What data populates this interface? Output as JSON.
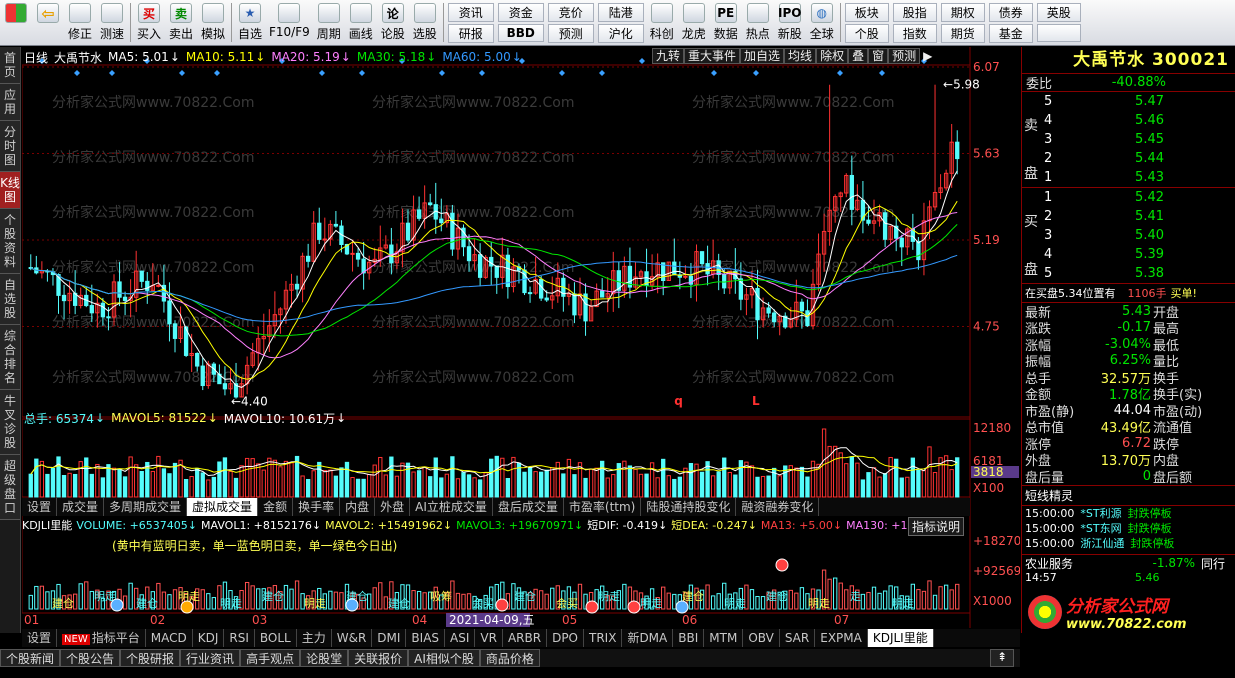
{
  "toolbar": {
    "items": [
      {
        "label": "",
        "icon": "grid-icon"
      },
      {
        "label": "",
        "icon": "back-arrow-icon"
      },
      {
        "label": "修正",
        "icon": "up-down-arrows-icon"
      },
      {
        "label": "测速",
        "icon": "timer-icon"
      },
      {
        "label": "买入",
        "icon": "buy-icon",
        "glyph": "买"
      },
      {
        "label": "卖出",
        "icon": "sell-icon",
        "glyph": "卖"
      },
      {
        "label": "模拟",
        "icon": "hammer-icon"
      },
      {
        "label": "自选",
        "icon": "star-icon"
      },
      {
        "label": "F10/F9",
        "icon": "f10-icon"
      },
      {
        "label": "周期",
        "icon": "cycle-icon"
      },
      {
        "label": "画线",
        "icon": "pen-icon"
      },
      {
        "label": "论股",
        "icon": "chat-icon",
        "glyph": "论"
      },
      {
        "label": "选股",
        "icon": "select-stock-icon"
      }
    ],
    "pairs": [
      [
        "资讯",
        "研报"
      ],
      [
        "资金",
        "BBD"
      ],
      [
        "竞价",
        "预测"
      ],
      [
        "陆港",
        "沪化"
      ]
    ],
    "items2": [
      {
        "label": "科创",
        "icon": "chart-icon"
      },
      {
        "label": "龙虎",
        "icon": "dragon-icon"
      },
      {
        "label": "数据",
        "icon": "pe-icon",
        "glyph": "PE"
      },
      {
        "label": "热点",
        "icon": "hot-icon"
      },
      {
        "label": "新股",
        "icon": "ipo-icon",
        "glyph": "IPO"
      },
      {
        "label": "全球",
        "icon": "globe-icon"
      }
    ],
    "pairs2": [
      [
        "板块",
        "个股"
      ],
      [
        "股指",
        "指数"
      ],
      [
        "期权",
        "期货"
      ],
      [
        "债券",
        "基金"
      ],
      [
        "英股",
        ""
      ]
    ]
  },
  "leftnav": [
    "首页",
    "应用",
    "分时图",
    "K线图",
    "个股资料",
    "自选股",
    "综合排名",
    "牛叉诊股",
    "超级盘口"
  ],
  "kline_header": {
    "period": "日线",
    "name": "大禹节水",
    "ma5": "MA5: 5.01",
    "ma10": "MA10: 5.11",
    "ma20": "MA20: 5.19",
    "ma30": "MA30: 5.18",
    "ma60": "MA60: 5.00",
    "buttons": [
      "九转",
      "重大事件",
      "加自选",
      "均线",
      "除权",
      "叠",
      "窗",
      "预测"
    ]
  },
  "price_axis": [
    "6.07",
    "5.63",
    "5.19",
    "4.75"
  ],
  "high_label": "5.98",
  "low_label": "4.40",
  "vol_header": {
    "total": "总手: 65374",
    "mavol5": "MAVOL5: 81522",
    "mavol10": "MAVOL10: 10.61万"
  },
  "vol_axis": [
    "12180",
    "6181",
    "3818",
    "X100"
  ],
  "vol_tabs": [
    "设置",
    "成交量",
    "多周期成交量",
    "虚拟成交量",
    "金额",
    "换手率",
    "内盘",
    "外盘",
    "AI立桩成交量",
    "盘后成交量",
    "市盈率(ttm)",
    "陆股通持股变化",
    "融资融券变化"
  ],
  "vol_tab_active": "虚拟成交量",
  "ind_header": {
    "name": "KDJLI里能",
    "volume": "VOLUME: +6537405",
    "mavol1": "MAVOL1: +8152176",
    "mavol2": "MAVOL2: +15491962",
    "mavol3": "MAVOL3: +19670971",
    "dif": "短DIF: -0.419",
    "dea": "短DEA: -0.247",
    "ma13": "MA13: +5.00",
    "ma130": "MA130: +11774",
    "explain": "指标说明"
  },
  "ind_note": "(黄中有蓝明日卖，单一蓝色明日卖，单一绿色今日出)",
  "ind_axis": [
    "+182702",
    "+92569",
    "X1000"
  ],
  "date_axis": [
    "01",
    "02",
    "03",
    "04",
    "05",
    "06",
    "07"
  ],
  "date_highlight": "2021-04-09,五",
  "ind_tabs": [
    "设置",
    "指标平台",
    "MACD",
    "KDJ",
    "RSI",
    "BOLL",
    "主力",
    "W&R",
    "DMI",
    "BIAS",
    "ASI",
    "VR",
    "ARBR",
    "DPO",
    "TRIX",
    "新DMA",
    "BBI",
    "MTM",
    "OBV",
    "SAR",
    "EXPMA",
    "KDJLI里能"
  ],
  "ind_tab_active": "KDJLI里能",
  "new_badge": "NEW",
  "bottom_tabs": [
    "个股新闻",
    "个股公告",
    "个股研报",
    "行业资讯",
    "高手观点",
    "论股堂",
    "关联报价",
    "AI相似个股",
    "商品价格"
  ],
  "stock_title": "大禹节水 300021",
  "weibi": {
    "label": "委比",
    "value": "-40.88%"
  },
  "sell_orders": [
    [
      "5",
      "5.47"
    ],
    [
      "4",
      "5.46"
    ],
    [
      "3",
      "5.45"
    ],
    [
      "2",
      "5.44"
    ],
    [
      "1",
      "5.43"
    ]
  ],
  "buy_orders": [
    [
      "1",
      "5.42"
    ],
    [
      "2",
      "5.41"
    ],
    [
      "3",
      "5.40"
    ],
    [
      "4",
      "5.39"
    ],
    [
      "5",
      "5.38"
    ]
  ],
  "side_sell": "卖盘",
  "side_buy": "买盘",
  "buy_note": {
    "text": "在买盘5.34位置有",
    "qty": "1106手",
    "tail": "买单!"
  },
  "quote": [
    [
      "最新",
      "5.43",
      "开盘",
      ""
    ],
    [
      "涨跌",
      "-0.17",
      "最高",
      ""
    ],
    [
      "涨幅",
      "-3.04%",
      "最低",
      ""
    ],
    [
      "振幅",
      "6.25%",
      "量比",
      ""
    ],
    [
      "总手",
      "32.57万",
      "换手",
      ""
    ],
    [
      "金额",
      "1.78亿",
      "换手(实)",
      ""
    ],
    [
      "市盈(静)",
      "44.04",
      "市盈(动)",
      ""
    ],
    [
      "总市值",
      "43.49亿",
      "流通值",
      ""
    ],
    [
      "涨停",
      "6.72",
      "跌停",
      ""
    ],
    [
      "外盘",
      "13.70万",
      "内盘",
      ""
    ],
    [
      "盘后量",
      "0",
      "盘后额",
      ""
    ]
  ],
  "short_title": "短线精灵",
  "short_list": [
    [
      "15:00:00",
      "*ST利源",
      "封跌停板"
    ],
    [
      "15:00:00",
      "*ST东网",
      "封跌停板"
    ],
    [
      "15:00:00",
      "浙江仙通",
      "封跌停板"
    ]
  ],
  "sector": {
    "name": "农业服务",
    "value": "-1.87%",
    "tail": "同行"
  },
  "ticker": {
    "time": "14:57",
    "price": "5.46"
  },
  "brand": {
    "name": "分析家公式网",
    "url": "www.70822.com"
  },
  "markers": {
    "q": "q",
    "L": "L"
  },
  "signal_texts": [
    "建仓",
    "明走",
    "建仓",
    "明走",
    "明走",
    "建仓",
    "明走",
    "建仓",
    "建仓",
    "吸筹",
    "会买",
    "建仓",
    "会买",
    "明走",
    "明走",
    "建仓",
    "明走",
    "建仓",
    "明走",
    "走",
    "明走"
  ],
  "watermark": "分析家公式网www.70822.Com",
  "colors": {
    "up": "#ff3232",
    "down": "#54fcfc",
    "ma5": "#ffffff",
    "ma10": "#ffff00",
    "ma20": "#ff80ff",
    "ma30": "#00e600",
    "ma60": "#3399ff",
    "grid": "#7a0000",
    "accent": "#ffff54"
  }
}
